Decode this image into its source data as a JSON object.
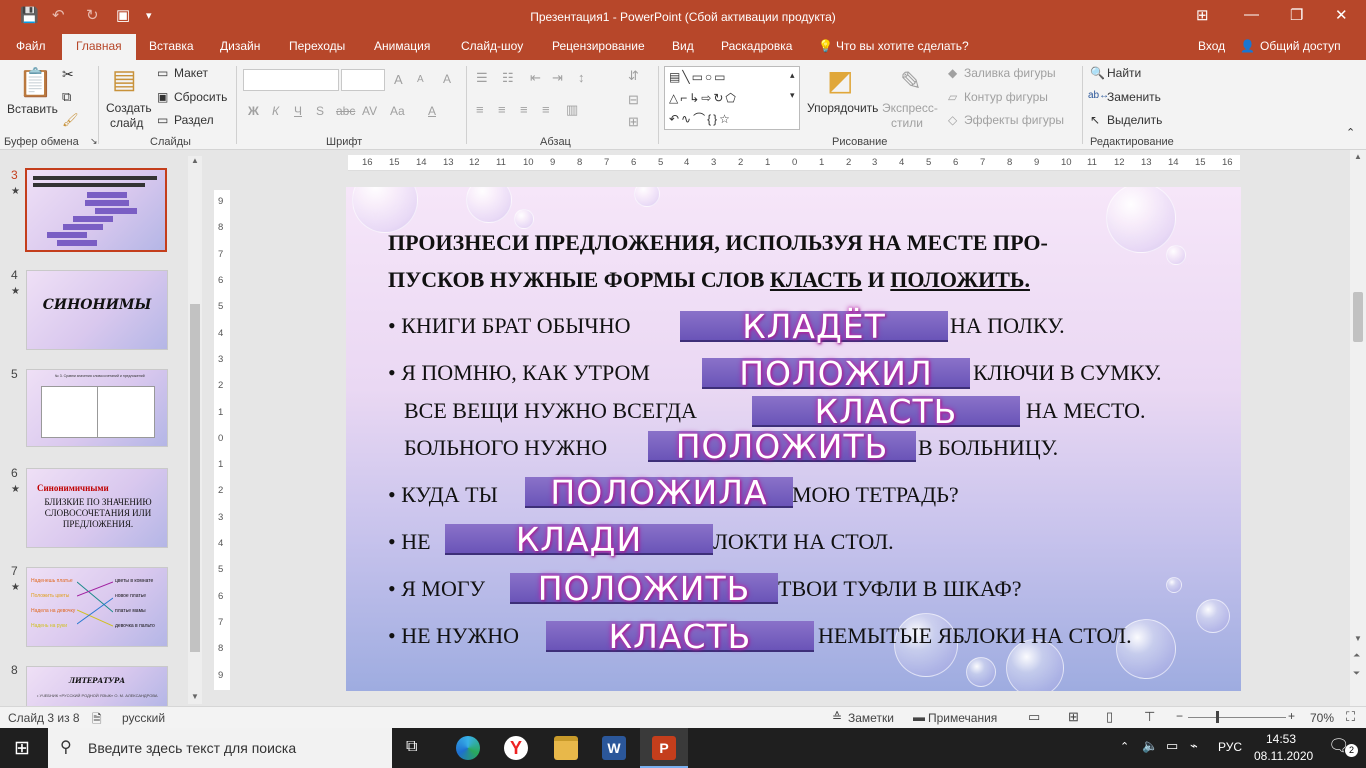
{
  "app": {
    "title": "Презентация1 - PowerPoint (Сбой активации продукта)",
    "accent": "#b7472a"
  },
  "quick_access": {
    "save": "💾",
    "undo": "↶",
    "redo": "↻",
    "present": "▣",
    "more": "▾"
  },
  "window_controls": {
    "ribbon_display": "⊞",
    "minimize": "—",
    "restore": "❐",
    "close": "✕"
  },
  "tabs": [
    "Файл",
    "Главная",
    "Вставка",
    "Дизайн",
    "Переходы",
    "Анимация",
    "Слайд-шоу",
    "Рецензирование",
    "Вид",
    "Раскадровка"
  ],
  "tell_me": "Что вы хотите сделать?",
  "signin": "Вход",
  "share": "Общий доступ",
  "ribbon": {
    "clipboard": {
      "paste": "Вставить",
      "group": "Буфер обмена"
    },
    "slides": {
      "new_slide_line1": "Создать",
      "new_slide_line2": "слайд",
      "layout": "Макет",
      "reset": "Сбросить",
      "section": "Раздел",
      "group": "Слайды"
    },
    "font": {
      "bold": "Ж",
      "italic": "К",
      "underline": "Ч",
      "shadow": "S",
      "strike": "abc",
      "spacing": "AV",
      "case": "Aa",
      "color": "A",
      "grow": "A",
      "shrink": "A",
      "clear": "A",
      "group": "Шрифт"
    },
    "paragraph": {
      "group": "Абзац"
    },
    "drawing": {
      "arrange": "Упорядочить",
      "quick_styles_line1": "Экспресс-",
      "quick_styles_line2": "стили",
      "fill": "Заливка фигуры",
      "outline": "Контур фигуры",
      "effects": "Эффекты фигуры",
      "group": "Рисование"
    },
    "editing": {
      "find": "Найти",
      "replace": "Заменить",
      "select": "Выделить",
      "group": "Редактирование"
    }
  },
  "ruler": {
    "h": [
      "16",
      "15",
      "14",
      "13",
      "12",
      "11",
      "10",
      "9",
      "8",
      "7",
      "6",
      "5",
      "4",
      "3",
      "2",
      "1",
      "0",
      "1",
      "2",
      "3",
      "4",
      "5",
      "6",
      "7",
      "8",
      "9",
      "10",
      "11",
      "12",
      "13",
      "14",
      "15",
      "16"
    ],
    "v": [
      "9",
      "8",
      "7",
      "6",
      "5",
      "4",
      "3",
      "2",
      "1",
      "0",
      "1",
      "2",
      "3",
      "4",
      "5",
      "6",
      "7",
      "8",
      "9"
    ]
  },
  "thumbnails": [
    {
      "num": "3",
      "star": "★",
      "selected": true
    },
    {
      "num": "4",
      "star": "★",
      "title": "СИНОНИМЫ"
    },
    {
      "num": "5",
      "star": "",
      "text": "№ 3. Сравни значения словосочетаний и предложений"
    },
    {
      "num": "6",
      "star": "★",
      "red": "Синонимичными",
      "black": "БЛИЗКИЕ ПО ЗНАЧЕНИЮ СЛОВОСОЧЕТАНИЯ ИЛИ ПРЕДЛОЖЕНИЯ."
    },
    {
      "num": "7",
      "star": "★",
      "left": [
        "Наденешь платье",
        "Положить цветы",
        "Надела на девочку",
        "Надень на руки"
      ],
      "right": [
        "цветы в комнате",
        "новое платье",
        "платье мамы",
        "девочка в пальто"
      ]
    },
    {
      "num": "8",
      "star": "",
      "title": "ЛИТЕРАТУРА",
      "text": "• УЧЕБНИК «РУССКИЙ РОДНОЙ ЯЗЫК» О. М. АЛЕКСАНДРОВА"
    }
  ],
  "slide": {
    "title_line1": "ПРОИЗНЕСИ ПРЕДЛОЖЕНИЯ, ИСПОЛЬЗУЯ НА МЕСТЕ ПРО-",
    "title_line2a": "ПУСКОВ НУЖНЫЕ ФОРМЫ СЛОВ ",
    "title_w1": "КЛАСТЬ",
    "title_and": " И ",
    "title_w2": "ПОЛОЖИТЬ.",
    "bullet": "•",
    "lines": [
      {
        "before": "КНИГИ БРАТ ОБЫЧНО",
        "after": "НА ПОЛКУ.",
        "answer": "КЛАДЁТ"
      },
      {
        "before": "Я ПОМНЮ, КАК УТРОМ",
        "after": "КЛЮЧИ В СУМКУ.",
        "answer": "ПОЛОЖИЛ"
      },
      {
        "before": "ВСЕ ВЕЩИ НУЖНО ВСЕГДА",
        "after": "НА МЕСТО.",
        "answer": "КЛАСТЬ"
      },
      {
        "before": "БОЛЬНОГО НУЖНО",
        "after": "В БОЛЬНИЦУ.",
        "answer": "ПОЛОЖИТЬ"
      },
      {
        "before": "КУДА ТЫ",
        "after": "МОЮ ТЕТРАДЬ?",
        "answer": "ПОЛОЖИЛА"
      },
      {
        "before": "НЕ",
        "after": "ЛОКТИ НА СТОЛ.",
        "answer": "КЛАДИ"
      },
      {
        "before": "Я МОГУ",
        "after": "ТВОИ ТУФЛИ В ШКАФ?",
        "answer": "ПОЛОЖИТЬ"
      },
      {
        "before": "НЕ НУЖНО",
        "after": "НЕМЫТЫЕ ЯБЛОКИ НА СТОЛ.",
        "answer": "КЛАСТЬ"
      }
    ]
  },
  "status": {
    "slide": "Слайд 3 из 8",
    "lang": "русский",
    "notes": "Заметки",
    "comments": "Примечания",
    "zoom": "70%"
  },
  "taskbar": {
    "search_placeholder": "Введите здесь текст для поиска",
    "lang": "РУС",
    "time": "14:53",
    "date": "08.11.2020",
    "notif": "2"
  }
}
